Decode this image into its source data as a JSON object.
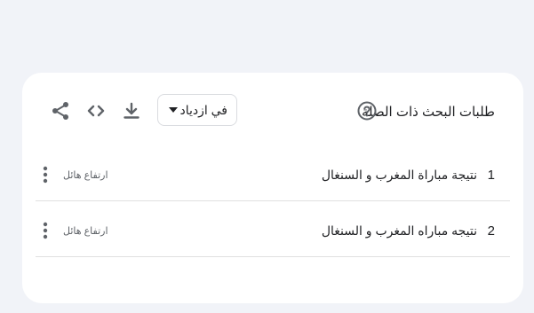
{
  "widget": {
    "title": "طلبات البحث ذات الصلة",
    "help_icon": "help-circle-icon",
    "sort": {
      "selected": "في ازدياد"
    },
    "tools": {
      "download_icon": "download-icon",
      "embed_icon": "code-embed-icon",
      "share_icon": "share-icon"
    }
  },
  "rows": [
    {
      "rank": "1",
      "query": "نتيجة مباراة المغرب و السنغال",
      "value": "ارتفاع هائل"
    },
    {
      "rank": "2",
      "query": "نتيجه مباراه المغرب و السنغال",
      "value": "ارتفاع هائل"
    }
  ],
  "colors": {
    "page_background": "#f1f3f8",
    "card_background": "#ffffff",
    "icon": "#5f6368",
    "text": "#202124"
  }
}
